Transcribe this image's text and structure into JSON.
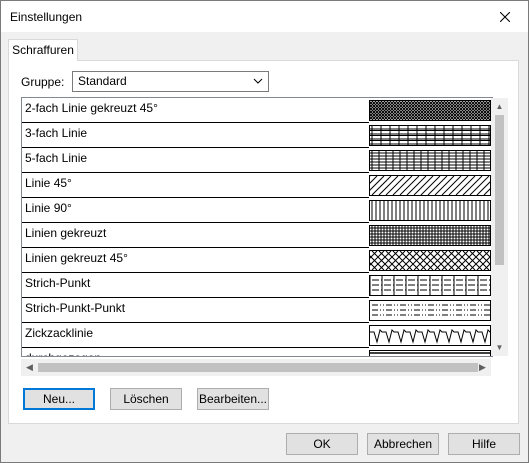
{
  "window": {
    "title": "Einstellungen"
  },
  "tabs": [
    {
      "label": "Schraffuren",
      "selected": true
    }
  ],
  "group": {
    "label": "Gruppe:",
    "value": "Standard"
  },
  "patterns": [
    {
      "label": "2-fach Linie gekreuzt 45°",
      "pattern": "crosshatch-dense",
      "selected": true
    },
    {
      "label": "3-fach Linie",
      "pattern": "triple-line"
    },
    {
      "label": "5-fach Linie",
      "pattern": "five-line"
    },
    {
      "label": "Linie 45°",
      "pattern": "diagonal-45"
    },
    {
      "label": "Linie 90°",
      "pattern": "vertical-90"
    },
    {
      "label": "Linien gekreuzt",
      "pattern": "grid-cross"
    },
    {
      "label": "Linien gekreuzt 45°",
      "pattern": "diamond-cross"
    },
    {
      "label": "Strich-Punkt",
      "pattern": "dash-dot"
    },
    {
      "label": "Strich-Punkt-Punkt",
      "pattern": "dash-dot-dot"
    },
    {
      "label": "Zickzacklinie",
      "pattern": "zigzag"
    },
    {
      "label": "durchgezogen",
      "pattern": "solid"
    }
  ],
  "buttons": {
    "new": "Neu...",
    "delete": "Löschen",
    "edit": "Bearbeiten...",
    "ok": "OK",
    "cancel": "Abbrechen",
    "help": "Hilfe"
  },
  "colors": {
    "accent": "#0078d7",
    "panel": "#f0f0f0"
  }
}
